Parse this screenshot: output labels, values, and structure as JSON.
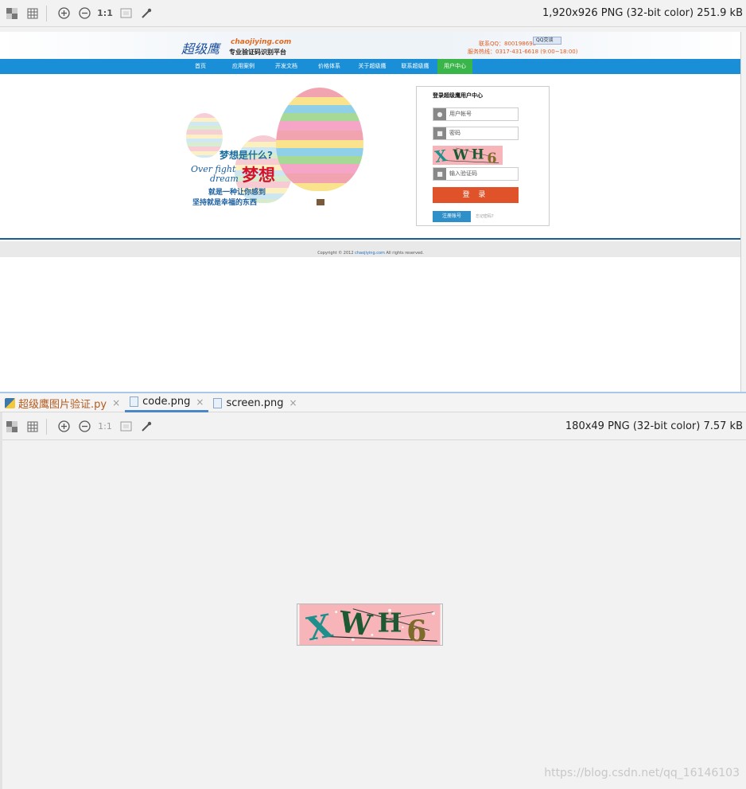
{
  "top_viewer": {
    "image_info": "1,920x926 PNG (32-bit color) 251.9 kB",
    "toolbar_labels": {
      "actual_size": "1:1"
    }
  },
  "site": {
    "logo_cn": "超级鹰",
    "logo_en": "chaojiying.com",
    "logo_tagline": "专业验证码识别平台",
    "contact_qq": "联系QQ：800198698",
    "contact_phone": "服务热线：0317-431-6618 (9:00~18:00)",
    "qq_badge": "QQ交谈",
    "nav": [
      "首页",
      "应用案例",
      "开发文档",
      "价格体系",
      "关于超级鹰",
      "联系超级鹰",
      "用户中心"
    ],
    "nav_active_index": 6,
    "slogan_line1": "梦想是什么?",
    "slogan_en1": "Over fight",
    "slogan_en2": "dream",
    "slogan_dream": "梦想",
    "slogan_line3": "就是一种让你感到",
    "slogan_line4": "坚持就是幸福的东西",
    "login": {
      "title": "登录超级鹰用户中心",
      "username_placeholder": "用户帐号",
      "password_placeholder": "密码",
      "captcha_placeholder": "输入验证码",
      "login_button": "登 录",
      "register_button": "注册账号",
      "forgot_link": "忘记密码?"
    },
    "footer": {
      "prefix": "Copyright © 2012 ",
      "domain": "chaojiying.com",
      "suffix": " All rights reserved."
    }
  },
  "editor": {
    "tabs": [
      {
        "label": "超级鹰图片验证.py",
        "close": "×"
      },
      {
        "label": "code.png",
        "close": "×"
      },
      {
        "label": "screen.png",
        "close": "×"
      }
    ],
    "active_tab_index": 1,
    "image_info": "180x49 PNG (32-bit color) 7.57 kB",
    "toolbar_labels": {
      "actual_size": "1:1"
    },
    "captcha_text": "XWH6"
  },
  "watermark": "https://blog.csdn.net/qq_16146103",
  "colors": {
    "nav_blue": "#1a8fd8",
    "nav_active": "#39b54a",
    "login_button": "#e0522a",
    "captcha_bg": "#f7b5b9"
  }
}
